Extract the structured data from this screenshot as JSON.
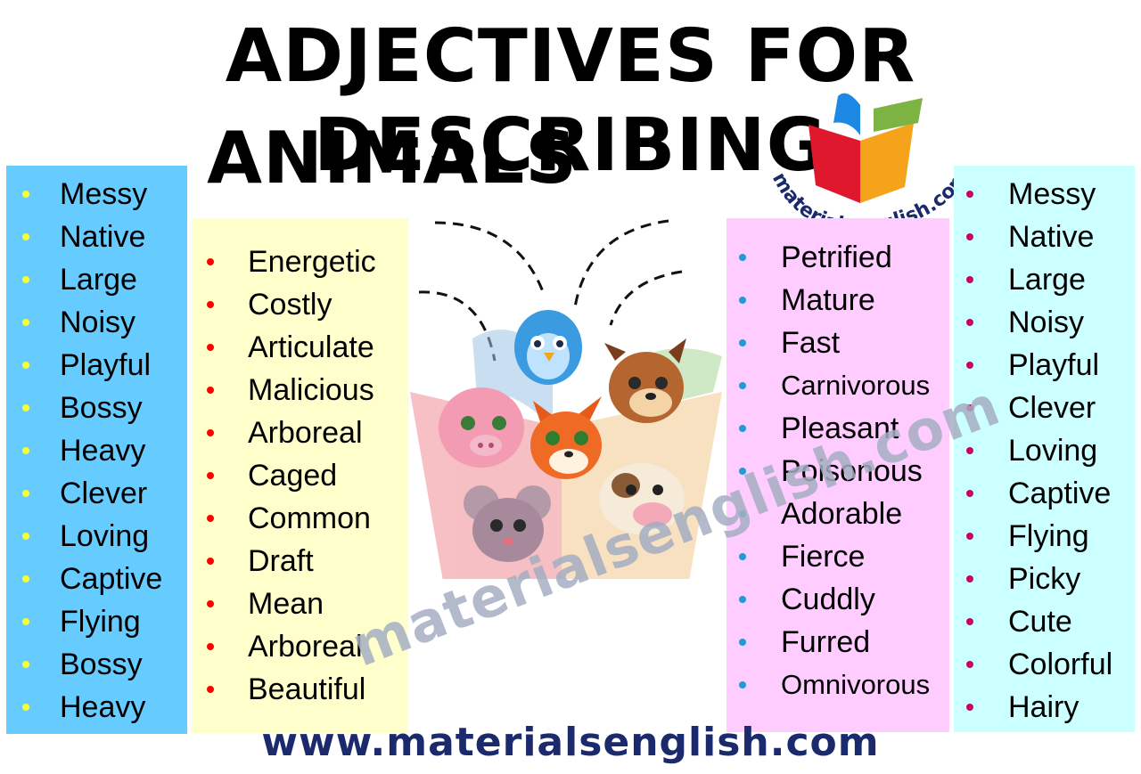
{
  "title": {
    "line1": "ADJECTIVES FOR DESCRIBING",
    "line2": "ANIMALS"
  },
  "colors": {
    "col1_bg": "#66ccff",
    "col1_bullet": "#ffff33",
    "col2_bg": "#ffffcc",
    "col2_bullet": "#ff0000",
    "col3_bg": "#ffccff",
    "col3_bullet": "#1f9bd6",
    "col4_bg": "#ccffff",
    "col4_bullet": "#cc0066",
    "footer_text": "#1a2a6c"
  },
  "columns": {
    "col1": [
      "Messy",
      "Native",
      "Large",
      "Noisy",
      "Playful",
      "Bossy",
      "Heavy",
      "Clever",
      "Loving",
      "Captive",
      "Flying",
      "Bossy",
      "Heavy"
    ],
    "col2": [
      "Energetic",
      "Costly",
      "Articulate",
      "Malicious",
      "Arboreal",
      "Caged",
      "Common",
      "Draft",
      "Mean",
      "Arboreal",
      "Beautiful"
    ],
    "col3": [
      "Petrified",
      "Mature",
      "Fast",
      "Carnivorous",
      "Pleasant",
      "Poisonous",
      "Adorable",
      "Fierce",
      "Cuddly",
      "Furred",
      "Omnivorous"
    ],
    "col4": [
      "Messy",
      "Native",
      "Large",
      "Noisy",
      "Playful",
      "Clever",
      "Loving",
      "Captive",
      "Flying",
      "Picky",
      "Cute",
      "Colorful",
      "Hairy"
    ]
  },
  "logo": {
    "text": "materialsenglish.com"
  },
  "watermark": {
    "text": "materialsenglish.com"
  },
  "footer": {
    "url": "www.materialsenglish.com"
  },
  "illustration": {
    "icons": [
      "book-icon",
      "bird-icon",
      "dog-icon",
      "pig-icon",
      "fox-icon",
      "cow-icon",
      "mouse-icon"
    ]
  }
}
